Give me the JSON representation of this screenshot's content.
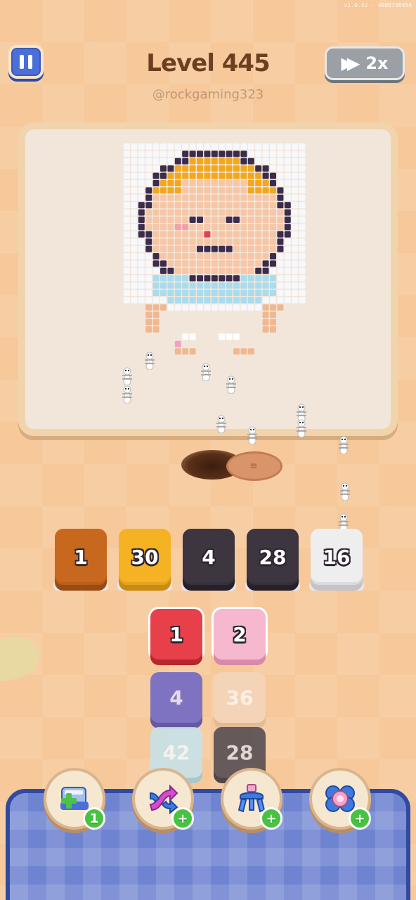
{
  "version": "v1.0.42 - 4908736454",
  "header": {
    "level_title": "Level 445",
    "username": "@rockgaming323",
    "speed_label": "2x"
  },
  "queue_slots": [
    {
      "count": "1",
      "color": "#c8681e",
      "edge": "#9a4c12"
    },
    {
      "count": "30",
      "color": "#f5b324",
      "edge": "#cc8a0e"
    },
    {
      "count": "4",
      "color": "#3d3540",
      "edge": "#25202a"
    },
    {
      "count": "28",
      "color": "#3d3540",
      "edge": "#25202a"
    },
    {
      "count": "16",
      "color": "#eeeeee",
      "edge": "#c4c4c8"
    }
  ],
  "tiles": [
    {
      "count": "1",
      "color": "#e8404a",
      "edge": "#b8262e",
      "faded": false
    },
    {
      "count": "2",
      "color": "#f6b8cf",
      "edge": "#d88aa8",
      "faded": false
    },
    {
      "count": "4",
      "color": "#6a64c8",
      "edge": "#4c46a0",
      "faded": true
    },
    {
      "count": "36",
      "color": "#f4d6bb",
      "edge": "#e0b896",
      "faded": true
    },
    {
      "count": "42",
      "color": "#c4e4ee",
      "edge": "#9cc8d8",
      "faded": true
    },
    {
      "count": "28",
      "color": "#4e4650",
      "edge": "#342e38",
      "faded": true
    }
  ],
  "boosters": [
    {
      "name": "add-slot",
      "badge": "1"
    },
    {
      "name": "shuffle",
      "badge": "+"
    },
    {
      "name": "magnet",
      "badge": "+"
    },
    {
      "name": "freeze",
      "badge": "+"
    }
  ],
  "colors": {
    "background": "#f6c89a",
    "board_frame": "#f1d3ac",
    "tray": "#6f84d0",
    "pause": "#4a6fd8"
  }
}
